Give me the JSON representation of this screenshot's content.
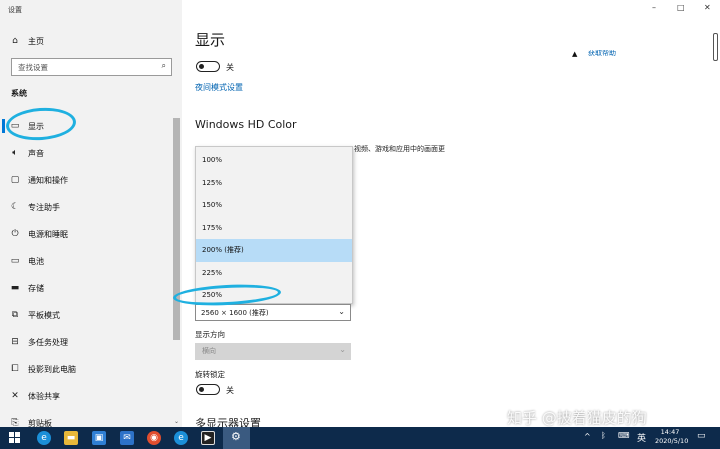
{
  "window": {
    "title": "设置",
    "controls": {
      "minimize": "–",
      "maximize": "□",
      "close": "✕"
    }
  },
  "sidebar": {
    "home": "主页",
    "search": {
      "placeholder": "查找设置"
    },
    "section": "系统",
    "items": [
      {
        "label": "显示",
        "icon": "monitor-icon"
      },
      {
        "label": "声音",
        "icon": "speaker-icon"
      },
      {
        "label": "通知和操作",
        "icon": "notification-icon"
      },
      {
        "label": "专注助手",
        "icon": "moon-icon"
      },
      {
        "label": "电源和睡眠",
        "icon": "power-icon"
      },
      {
        "label": "电池",
        "icon": "battery-icon"
      },
      {
        "label": "存储",
        "icon": "storage-icon"
      },
      {
        "label": "平板模式",
        "icon": "tablet-icon"
      },
      {
        "label": "多任务处理",
        "icon": "multitask-icon"
      },
      {
        "label": "投影到此电脑",
        "icon": "project-icon"
      },
      {
        "label": "体验共享",
        "icon": "share-icon"
      },
      {
        "label": "剪贴板",
        "icon": "clipboard-icon"
      }
    ]
  },
  "main": {
    "title": "显示",
    "night_light_state": "关",
    "night_light_link": "夜间模式设置",
    "get_help": "获取帮助",
    "hdr_heading": "Windows HD Color",
    "hdr_desc_tail": "视频、游戏和应用中的画面更",
    "scale_options": [
      "100%",
      "125%",
      "150%",
      "175%",
      "200% (推荐)",
      "225%",
      "250%"
    ],
    "scale_selected": "200% (推荐)",
    "resolution_value": "2560 × 1600 (推荐)",
    "orientation_label": "显示方向",
    "orientation_value": "横向",
    "rotation_lock_label": "旋转锁定",
    "rotation_lock_state": "关",
    "multi_display_heading": "多显示器设置"
  },
  "watermark": "知乎 @披着猫皮的狗",
  "taskbar": {
    "tray_lang": "英",
    "time": "14:47",
    "date": "2020/5/10"
  },
  "colors": {
    "accent": "#0078d7",
    "annotation": "#1fb0e0",
    "taskbar": "#0d2a4b",
    "selected": "#b7dcf7"
  }
}
